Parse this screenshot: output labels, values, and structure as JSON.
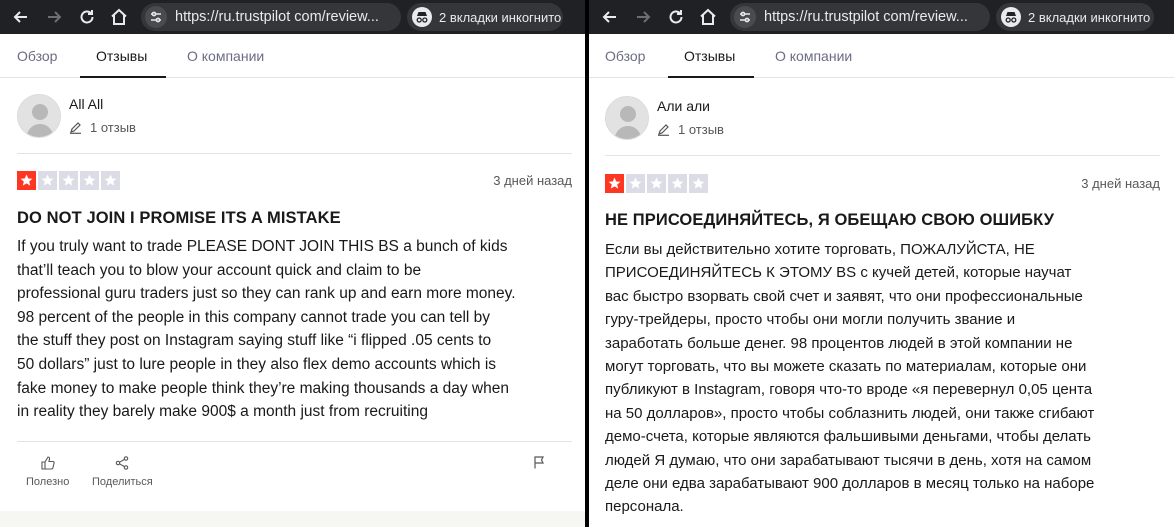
{
  "colors": {
    "brand_star": "#ff3722",
    "star_empty": "#dcdce6",
    "browser_bar": "#202124",
    "text_primary": "#191919",
    "text_secondary": "#585858"
  },
  "left": {
    "browser": {
      "url": "https://ru.trustpilot com/review...",
      "incognito_label": "2 вкладки инкогнито"
    },
    "tabs": [
      "Обзор",
      "Отзывы",
      "О компании"
    ],
    "reviewer": {
      "name": "All All",
      "review_count": "1 отзыв"
    },
    "rating": 1,
    "date": "3 дней назад",
    "title": "DO NOT JOIN I PROMISE ITS A MISTAKE",
    "body": [
      "If you truly want to trade PLEASE DONT JOIN THIS BS a bunch of kids",
      "that’ll teach you to blow your account quick and claim to be",
      "professional guru traders just so they can rank up and earn more money.",
      "98 percent of the people in this company cannot trade you can tell by",
      "the stuff they post on Instagram saying stuff like “i flipped .05 cents to",
      "50 dollars” just to lure people in they also flex demo accounts which is",
      "fake money to make people think they’re making thousands a day when",
      "in reality they barely make 900$ a month just from recruiting"
    ],
    "actions": {
      "useful": "Полезно",
      "share": "Поделиться"
    }
  },
  "right": {
    "browser": {
      "url": "https://ru.trustpilot com/review...",
      "incognito_label": "2 вкладки инкогнито"
    },
    "tabs": [
      "Обзор",
      "Отзывы",
      "О компании"
    ],
    "reviewer": {
      "name": "Али али",
      "review_count": "1 отзыв"
    },
    "rating": 1,
    "date": "3 дней назад",
    "title": "НЕ ПРИСОЕДИНЯЙТЕСЬ, Я ОБЕЩАЮ СВОЮ ОШИБКУ",
    "body": [
      "Если вы действительно хотите торговать, ПОЖАЛУЙСТА, НЕ",
      "ПРИСОЕДИНЯЙТЕСЬ К ЭТОМУ BS с кучей детей, которые научат",
      "вас быстро взорвать свой счет и заявят, что они профессиональные",
      "гуру-трейдеры, просто чтобы они могли получить звание и",
      "заработать больше денег. 98 процентов людей в этой компании не",
      "могут торговать, что вы можете сказать по материалам, которые они",
      "публикуют в Instagram, говоря что-то вроде «я перевернул 0,05 цента",
      "на 50 долларов», просто чтобы соблазнить людей, они также сгибают",
      "демо-счета, которые являются фальшивыми деньгами, чтобы делать",
      "людей Я думаю, что они зарабатывают тысячи в день, хотя на самом",
      "деле они едва зарабатывают 900 долларов в месяц только на наборе",
      "персонала."
    ]
  }
}
